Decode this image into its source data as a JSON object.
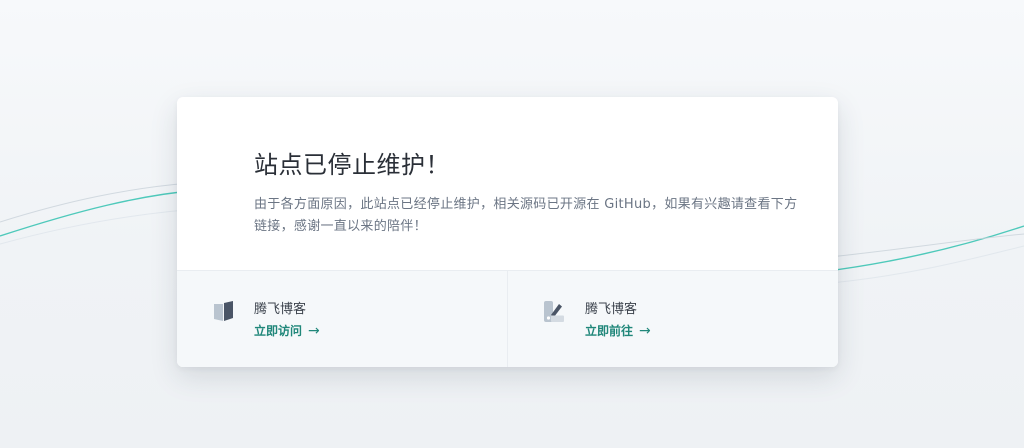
{
  "notice": {
    "title": "站点已停止维护！",
    "description": "由于各方面原因，此站点已经停止维护，相关源码已开源在 GitHub，如果有兴趣请查看下方链接，感谢一直以来的陪伴！"
  },
  "links": [
    {
      "label": "腾飞博客",
      "action": "立即访问",
      "arrow": "→",
      "icon": "book-icon"
    },
    {
      "label": "腾飞博客",
      "action": "立即前往",
      "arrow": "→",
      "icon": "design-tools-icon"
    }
  ],
  "colors": {
    "accent": "#20877a",
    "wave": "#3cc4b4",
    "card_background": "#ffffff",
    "footer_background": "#f5f8fa"
  }
}
